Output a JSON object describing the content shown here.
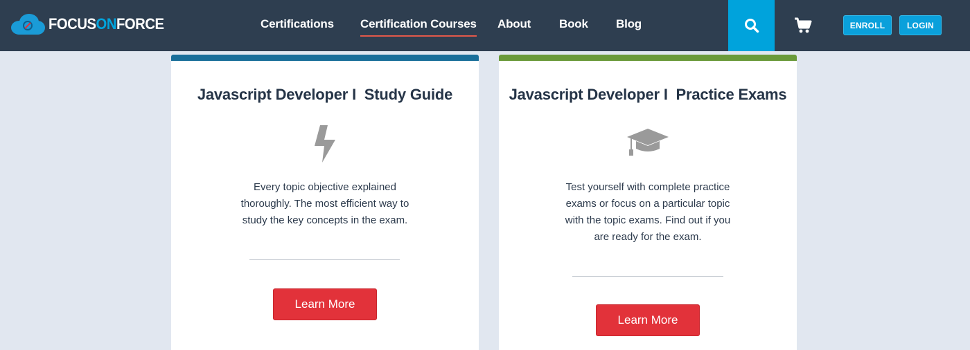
{
  "header": {
    "logo": {
      "part1": "FOCUS",
      "part2": "ON",
      "part3": "FORCE",
      "icon": "cloud-logo-icon"
    },
    "nav": [
      {
        "label": "Certifications",
        "active": false
      },
      {
        "label": "Certification Courses",
        "active": true
      },
      {
        "label": "About",
        "active": false
      },
      {
        "label": "Book",
        "active": false
      },
      {
        "label": "Blog",
        "active": false
      }
    ],
    "search_icon": "search-icon",
    "cart_icon": "cart-icon",
    "enroll_label": "ENROLL",
    "login_label": "LOGIN"
  },
  "cards": [
    {
      "title": "Javascript Developer I  Study Guide",
      "icon": "lightning-bolt-icon",
      "description": "Every topic objective explained thoroughly. The most efficient way to study the key concepts in the exam.",
      "button_label": "Learn More",
      "accent_color": "#1a6f9a"
    },
    {
      "title": "Javascript Developer I  Practice Exams",
      "icon": "graduation-cap-icon",
      "description": "Test yourself with complete practice exams or focus on a particular topic with the topic exams. Find out if you are ready for the exam.",
      "button_label": "Learn More",
      "accent_color": "#6a9a3a"
    }
  ],
  "colors": {
    "header_bg": "#2e3e50",
    "search_bg": "#00a3dc",
    "page_bg": "#e1e7f0",
    "button_red": "#e2323a",
    "nav_underline": "#e2584a"
  }
}
